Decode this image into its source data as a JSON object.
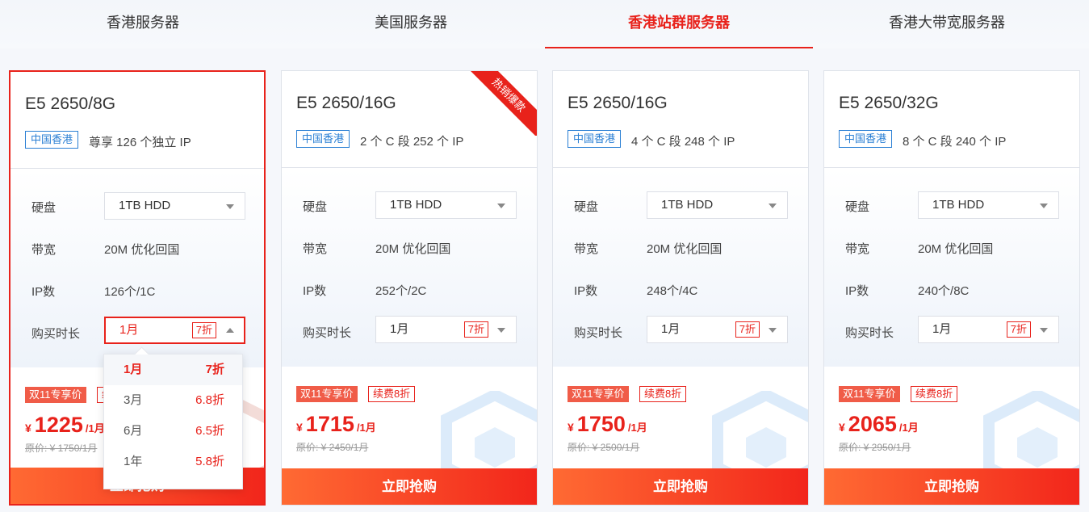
{
  "tabs": [
    {
      "label": "香港服务器"
    },
    {
      "label": "美国服务器"
    },
    {
      "label": "香港站群服务器"
    },
    {
      "label": "香港大带宽服务器"
    }
  ],
  "labels": {
    "disk": "硬盘",
    "bandwidth": "带宽",
    "ip_count": "IP数",
    "duration": "购买时长",
    "buy_button": "立即抢购",
    "promo_tag": "双11专享价",
    "renew_tag": "续费8折",
    "currency": "¥",
    "per_month": "/1月",
    "hot_ribbon": "热销爆款"
  },
  "cards": [
    {
      "title": "E5 2650/8G",
      "location": "中国香港",
      "ip_desc": "尊享 126 个独立 IP",
      "disk": "1TB HDD",
      "bandwidth": "20M 优化回国",
      "ip_count": "126个/1C",
      "duration": "1月",
      "discount": "7折",
      "price": "1225",
      "original": "原价: ¥ 1750/1月"
    },
    {
      "title": "E5 2650/16G",
      "location": "中国香港",
      "ip_desc": "2 个 C 段 252 个 IP",
      "disk": "1TB HDD",
      "bandwidth": "20M 优化回国",
      "ip_count": "252个/2C",
      "duration": "1月",
      "discount": "7折",
      "price": "1715",
      "original": "原价: ¥ 2450/1月"
    },
    {
      "title": "E5 2650/16G",
      "location": "中国香港",
      "ip_desc": "4 个 C 段 248 个 IP",
      "disk": "1TB HDD",
      "bandwidth": "20M 优化回国",
      "ip_count": "248个/4C",
      "duration": "1月",
      "discount": "7折",
      "price": "1750",
      "original": "原价: ¥ 2500/1月"
    },
    {
      "title": "E5 2650/32G",
      "location": "中国香港",
      "ip_desc": "8 个 C 段 240 个 IP",
      "disk": "1TB HDD",
      "bandwidth": "20M 优化回国",
      "ip_count": "240个/8C",
      "duration": "1月",
      "discount": "7折",
      "price": "2065",
      "original": "原价: ¥ 2950/1月"
    }
  ],
  "dropdown": {
    "options": [
      {
        "label": "1月",
        "discount": "7折"
      },
      {
        "label": "3月",
        "discount": "6.8折"
      },
      {
        "label": "6月",
        "discount": "6.5折"
      },
      {
        "label": "1年",
        "discount": "5.8折"
      }
    ]
  },
  "colors": {
    "accent": "#e8221b",
    "location_blue": "#2a7fd4",
    "button_start": "#ff6a33",
    "button_end": "#f2261b"
  }
}
